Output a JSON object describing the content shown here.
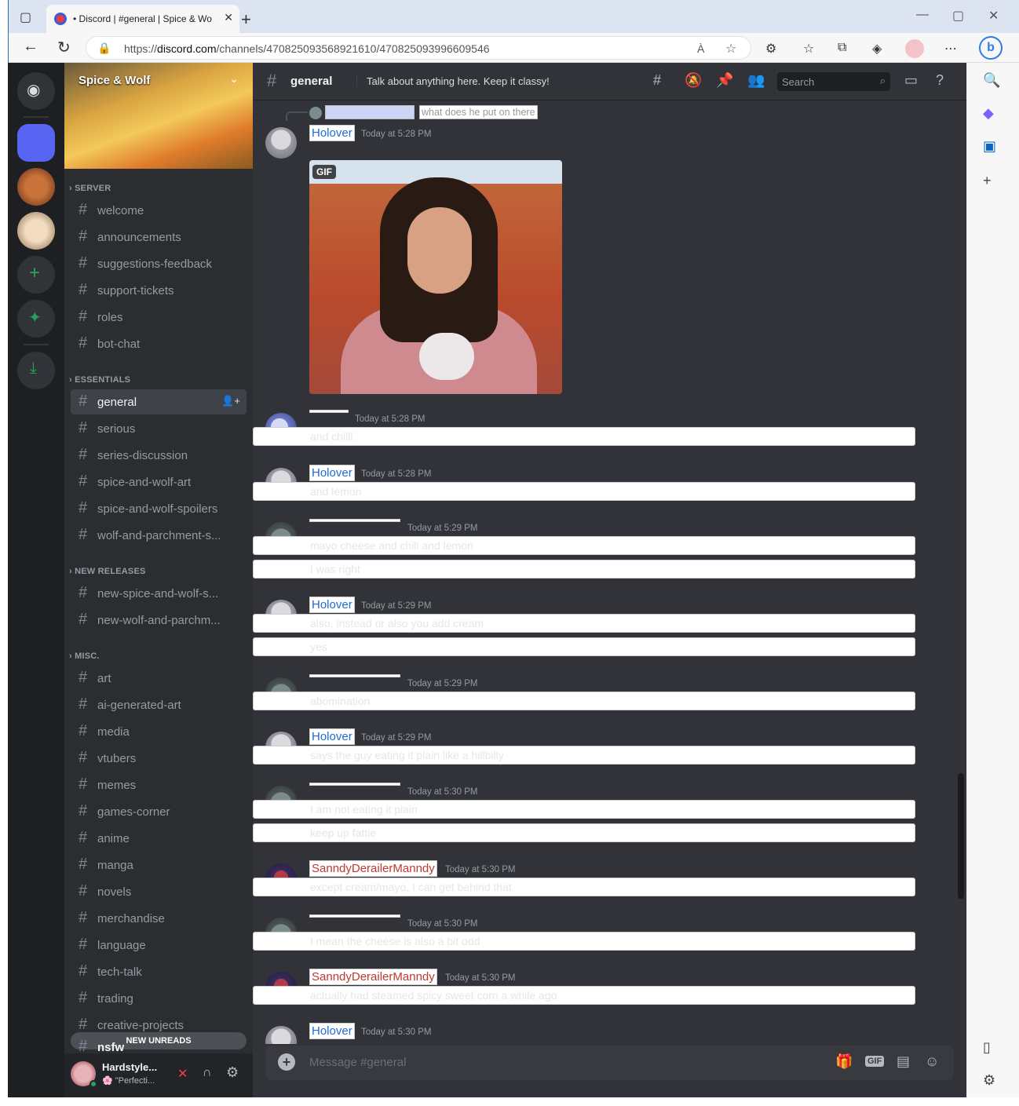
{
  "browser": {
    "tab_title": "• Discord | #general | Spice & Wo",
    "url_prefix": "https://",
    "url_domain": "discord.com",
    "url_path": "/channels/470825093568921610/470825093996609546",
    "read_aloud": "À"
  },
  "server": {
    "name": "Spice & Wolf",
    "categories": [
      {
        "label": "SERVER",
        "channels": [
          "welcome",
          "announcements",
          "suggestions-feedback",
          "support-tickets",
          "roles",
          "bot-chat"
        ]
      },
      {
        "label": "ESSENTIALS",
        "channels": [
          "general",
          "serious",
          "series-discussion",
          "spice-and-wolf-art",
          "spice-and-wolf-spoilers",
          "wolf-and-parchment-s..."
        ]
      },
      {
        "label": "NEW RELEASES",
        "channels": [
          "new-spice-and-wolf-s...",
          "new-wolf-and-parchm..."
        ]
      },
      {
        "label": "MISC.",
        "channels": [
          "art",
          "ai-generated-art",
          "media",
          "vtubers",
          "memes",
          "games-corner",
          "anime",
          "manga",
          "novels",
          "merchandise",
          "language",
          "tech-talk",
          "trading",
          "creative-projects",
          "nsfw"
        ]
      }
    ],
    "active_channel": "general",
    "new_unreads": "NEW UNREADS"
  },
  "user_panel": {
    "name": "Hardstyle...",
    "status": "\"Perfecti..."
  },
  "header": {
    "channel": "general",
    "topic": "Talk about anything here. Keep it classy!",
    "search_placeholder": "Search"
  },
  "reply": {
    "text": "what does he put on there"
  },
  "messages": [
    {
      "author": "Holover",
      "time": "Today at 5:28 PM",
      "gif_badge": "GIF"
    },
    {
      "author": "",
      "time": "Today at 5:28 PM",
      "lines": [
        "and chilli"
      ]
    },
    {
      "author": "Holover",
      "time": "Today at 5:28 PM",
      "lines": [
        "and lemon"
      ]
    },
    {
      "author": "",
      "time": "Today at 5:29 PM",
      "lines": [
        "mayo cheese and chili and lemon",
        "I was right"
      ]
    },
    {
      "author": "Holover",
      "time": "Today at 5:29 PM",
      "lines": [
        "also, instead or also you add cream",
        "yes"
      ]
    },
    {
      "author": "",
      "time": "Today at 5:29 PM",
      "lines": [
        "abomination"
      ]
    },
    {
      "author": "Holover",
      "time": "Today at 5:29 PM",
      "lines": [
        "says the guy eating it plain like a hillbilly"
      ]
    },
    {
      "author": "",
      "time": "Today at 5:30 PM",
      "lines": [
        "I am not eating it plain",
        "keep up fattie"
      ]
    },
    {
      "author": "SanndyDerailerManndy",
      "time": "Today at 5:30 PM",
      "lines": [
        "except cream/mayo, I can get behind that"
      ]
    },
    {
      "author": "",
      "time": "Today at 5:30 PM",
      "lines": [
        "I mean the cheese is also a bit odd"
      ]
    },
    {
      "author": "SanndyDerailerManndy",
      "time": "Today at 5:30 PM",
      "lines": [
        "actually had steamed spicy sweet corn a while ago"
      ]
    },
    {
      "author": "Holover",
      "time": "Today at 5:30 PM",
      "lines": []
    }
  ],
  "composer": {
    "placeholder": "Message #general",
    "gif_label": "GIF"
  }
}
